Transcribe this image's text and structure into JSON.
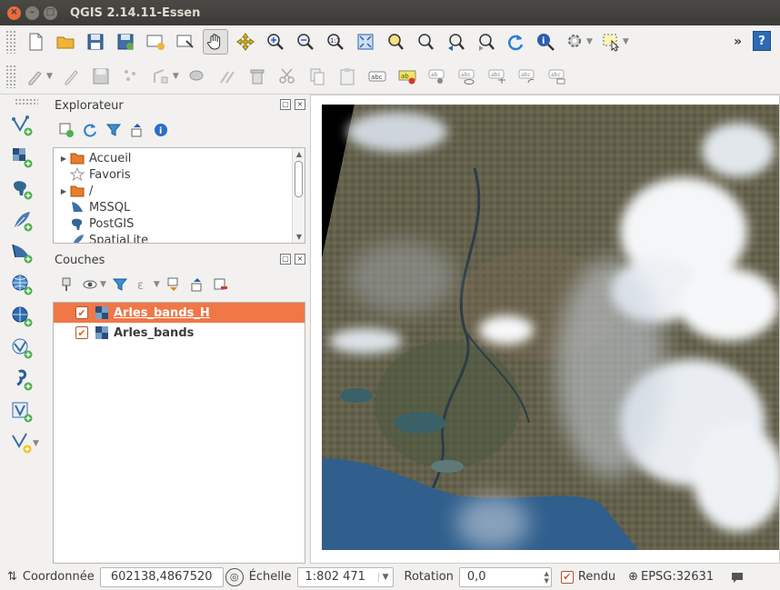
{
  "window": {
    "title": "QGIS 2.14.11-Essen",
    "close_glyph": "×",
    "min_glyph": "–",
    "max_glyph": "□"
  },
  "toolbar": {
    "overflow_glyph": "»",
    "help_glyph": "?"
  },
  "explorer": {
    "title": "Explorateur",
    "items": [
      {
        "label": "Accueil",
        "icon": "folder-icon",
        "expandable": true
      },
      {
        "label": "Favoris",
        "icon": "star-icon",
        "expandable": false
      },
      {
        "label": "/",
        "icon": "folder-icon",
        "expandable": true
      },
      {
        "label": "MSSQL",
        "icon": "mssql-icon",
        "expandable": false
      },
      {
        "label": "PostGIS",
        "icon": "postgis-icon",
        "expandable": false
      },
      {
        "label": "SpatiaLite",
        "icon": "spatialite-icon",
        "expandable": false
      }
    ]
  },
  "layers": {
    "title": "Couches",
    "items": [
      {
        "label": "Arles_bands_H",
        "checked": true,
        "selected": true,
        "icon": "raster-layer-icon"
      },
      {
        "label": "Arles_bands",
        "checked": true,
        "selected": false,
        "icon": "raster-layer-icon"
      }
    ]
  },
  "panel_buttons": {
    "float": "▢",
    "close": "×"
  },
  "status": {
    "coord_label": "Coordonnée",
    "coord_value": "602138,4867520",
    "scale_label": "Échelle",
    "scale_value": "1:802 471",
    "rotation_label": "Rotation",
    "rotation_value": "0,0",
    "render_label": "Rendu",
    "render_checked": true,
    "crs_label": "EPSG:32631"
  },
  "colors": {
    "accent": "#f07746",
    "titlebar": "#3c3b37",
    "sea": "#2b5886",
    "land": "#5d5a47"
  }
}
